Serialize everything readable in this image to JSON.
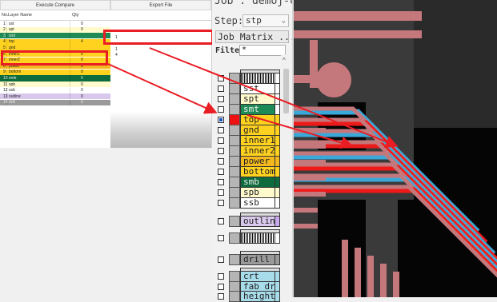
{
  "compare_table": {
    "title": "Execute Compare",
    "export_title": "Export File",
    "columns": [
      "No.",
      "Layer Name",
      "Qty"
    ],
    "rows": [
      {
        "no": "1",
        "name": "sst",
        "qty": "0",
        "color": "#ffffff"
      },
      {
        "no": "2",
        "name": "spt",
        "qty": "0",
        "color": "#fffbcc"
      },
      {
        "no": "3",
        "name": "smt",
        "qty": "",
        "color": "#1e8a55"
      },
      {
        "no": "4",
        "name": "top",
        "qty": "4",
        "color": "#ffd21f"
      },
      {
        "no": "5",
        "name": "gnd",
        "qty": "",
        "color": "#ffd21f"
      },
      {
        "no": "6",
        "name": "inner1",
        "qty": "5",
        "color": "#ffd21f"
      },
      {
        "no": "7",
        "name": "inner2",
        "qty": "0",
        "color": "#ffd21f"
      },
      {
        "no": "8",
        "name": "power",
        "qty": "0",
        "color": "#f2b81e"
      },
      {
        "no": "9",
        "name": "bottom",
        "qty": "0",
        "color": "#ffd21f"
      },
      {
        "no": "10",
        "name": "smb",
        "qty": "0",
        "color": "#0d6b3d"
      },
      {
        "no": "11",
        "name": "spb",
        "qty": "0",
        "color": "#fffbcc"
      },
      {
        "no": "12",
        "name": "ssb",
        "qty": "0",
        "color": "#ffffff"
      },
      {
        "no": "13",
        "name": "outline",
        "qty": "0",
        "color": "#d8c8ec"
      },
      {
        "no": "14",
        "name": "drill",
        "qty": "0",
        "color": "#9a9a9a"
      }
    ],
    "export_rows": [
      "1",
      "",
      "1",
      "4"
    ]
  },
  "panel": {
    "job_label": "Job : demoj-com",
    "step_label": "Step:",
    "step_value": "stp",
    "job_matrix_button": "Job Matrix ...",
    "filter_label": "Filter",
    "filter_value": "*"
  },
  "layers": [
    {
      "name": "",
      "fill": "barcode",
      "side": "#ffffff",
      "checked": false,
      "cap": true
    },
    {
      "name": "sst",
      "fill": "#ffffff",
      "side": "#ffffff",
      "checked": false
    },
    {
      "name": "spt",
      "fill": "#fffbcc",
      "side": "#ffffff",
      "checked": false
    },
    {
      "name": "smt",
      "fill": "#1e8a55",
      "side": "#ffffff",
      "checked": false
    },
    {
      "name": "top",
      "fill": "#ffd21f",
      "side": "#ffd21f",
      "checked": true
    },
    {
      "name": "gnd",
      "fill": "#ffd21f",
      "side": "#ffd21f",
      "checked": false
    },
    {
      "name": "inner1",
      "fill": "#ffd21f",
      "side": "#ffd21f",
      "checked": false
    },
    {
      "name": "inner2",
      "fill": "#ffd21f",
      "side": "#ffd21f",
      "checked": false
    },
    {
      "name": "power",
      "fill": "#f2b81e",
      "side": "#f2b81e",
      "checked": false
    },
    {
      "name": "bottom",
      "fill": "#ffd21f",
      "side": "#ffd21f",
      "checked": false
    },
    {
      "name": "smb",
      "fill": "#0d6b3d",
      "side": "#0d6b3d",
      "checked": false
    },
    {
      "name": "spb",
      "fill": "#fffbcc",
      "side": "#fffbcc",
      "checked": false
    },
    {
      "name": "ssb",
      "fill": "#ffffff",
      "side": "#ffffff",
      "checked": false
    },
    {
      "name": "outlin",
      "fill": "#d8c8ec",
      "side": "#c9a8f0",
      "checked": false,
      "cap": true
    },
    {
      "name": "",
      "fill": "barcode",
      "side": "#ffffff",
      "checked": false,
      "cap": true
    },
    {
      "name": "drill",
      "fill": "#9a9a9a",
      "side": "#9a9a9a",
      "checked": false,
      "cap": true
    },
    {
      "name": "crt",
      "fill": "#a8dceb",
      "side": "#a8dceb",
      "checked": false,
      "cap": true
    },
    {
      "name": "fab_dr",
      "fill": "#a8dceb",
      "side": "#a8dceb",
      "checked": false
    },
    {
      "name": "height",
      "fill": "#a8dceb",
      "side": "#a8dceb",
      "checked": false
    }
  ],
  "colors": {
    "annotation_red": "#ea1c24",
    "board_bg": "#3a3a3a",
    "trace_pink": "#c5787c",
    "trace_blue": "#3aa8d8"
  }
}
